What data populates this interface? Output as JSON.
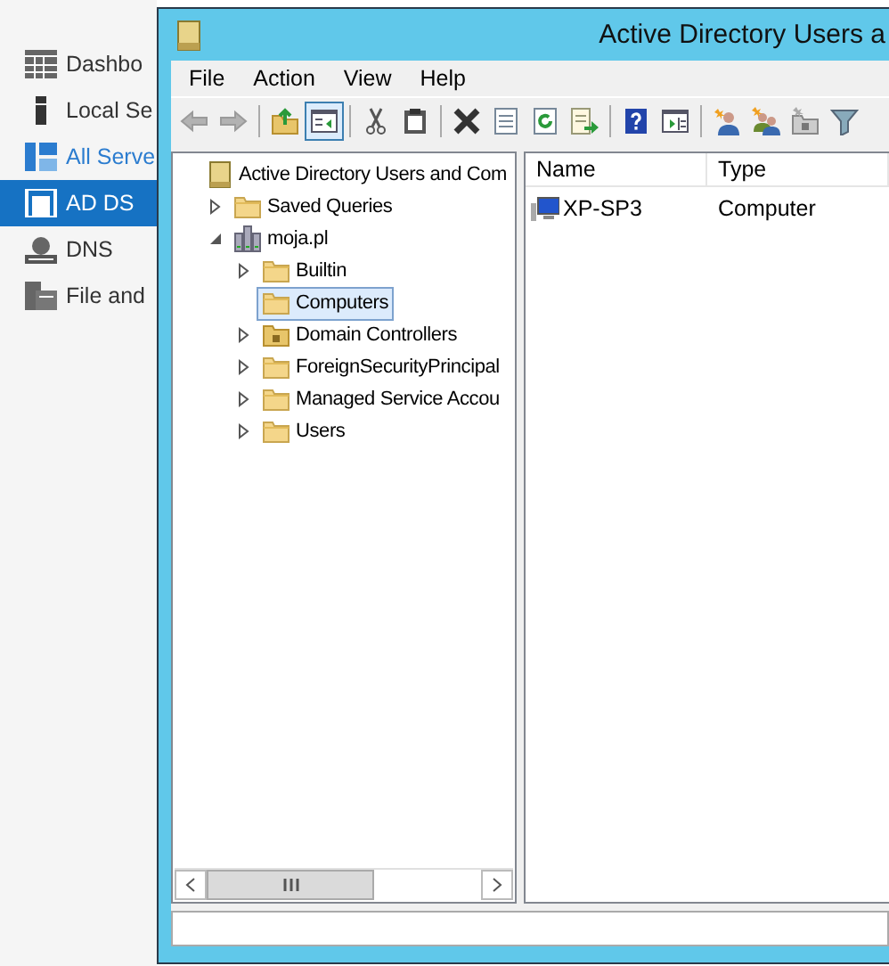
{
  "sidebar": {
    "items": [
      {
        "label": "Dashbo",
        "kind": "dashboard",
        "selected": false,
        "hovered": false
      },
      {
        "label": "Local Se",
        "kind": "server",
        "selected": false,
        "hovered": false
      },
      {
        "label": "All Serve",
        "kind": "servers",
        "selected": false,
        "hovered": true
      },
      {
        "label": "AD DS",
        "kind": "adds",
        "selected": true,
        "hovered": false
      },
      {
        "label": "DNS",
        "kind": "dns",
        "selected": false,
        "hovered": false
      },
      {
        "label": "File and",
        "kind": "files",
        "selected": false,
        "hovered": false
      }
    ]
  },
  "window": {
    "title": "Active Directory Users a",
    "menu": [
      "File",
      "Action",
      "View",
      "Help"
    ],
    "toolbar": [
      [
        {
          "kind": "back",
          "disabled": true,
          "selected": false
        },
        {
          "kind": "forward",
          "disabled": true,
          "selected": false
        }
      ],
      [
        {
          "kind": "up",
          "disabled": false,
          "selected": false
        },
        {
          "kind": "tree",
          "disabled": false,
          "selected": true
        }
      ],
      [
        {
          "kind": "cut",
          "disabled": false,
          "selected": false
        },
        {
          "kind": "paste",
          "disabled": false,
          "selected": false
        }
      ],
      [
        {
          "kind": "delete",
          "disabled": false,
          "selected": false
        },
        {
          "kind": "properties",
          "disabled": false,
          "selected": false
        },
        {
          "kind": "refresh",
          "disabled": false,
          "selected": false
        },
        {
          "kind": "export",
          "disabled": false,
          "selected": false
        }
      ],
      [
        {
          "kind": "help",
          "disabled": false,
          "selected": false
        },
        {
          "kind": "pane",
          "disabled": false,
          "selected": false
        }
      ],
      [
        {
          "kind": "user",
          "disabled": false,
          "selected": false
        },
        {
          "kind": "group",
          "disabled": false,
          "selected": false
        },
        {
          "kind": "ou",
          "disabled": false,
          "selected": false
        },
        {
          "kind": "filter",
          "disabled": false,
          "selected": false
        }
      ]
    ],
    "tree": [
      {
        "label": "Active Directory Users and Com",
        "kind": "snapin",
        "selected": false,
        "children": [
          {
            "label": "Saved Queries",
            "kind": "folder",
            "expanded": false,
            "selected": false
          },
          {
            "label": "moja.pl",
            "kind": "domain",
            "expanded": true,
            "selected": false,
            "children": [
              {
                "label": "Builtin",
                "kind": "folder",
                "expanded": false,
                "selected": false
              },
              {
                "label": "Computers",
                "kind": "folder",
                "selected": true
              },
              {
                "label": "Domain Controllers",
                "kind": "ou",
                "expanded": false,
                "selected": false
              },
              {
                "label": "ForeignSecurityPrincipal",
                "kind": "folder",
                "expanded": false,
                "selected": false
              },
              {
                "label": "Managed Service Accou",
                "kind": "folder",
                "expanded": false,
                "selected": false
              },
              {
                "label": "Users",
                "kind": "folder",
                "expanded": false,
                "selected": false
              }
            ]
          }
        ]
      }
    ],
    "list": {
      "columns": [
        "Name",
        "Type"
      ],
      "rows": [
        {
          "kind": "computer",
          "cells": [
            "XP-SP3",
            "Computer"
          ]
        }
      ]
    }
  }
}
